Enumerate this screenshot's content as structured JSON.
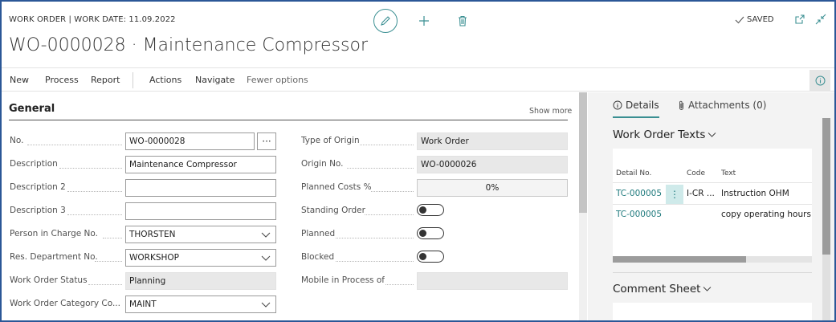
{
  "header": {
    "context": "WORK ORDER | WORK DATE: 11.09.2022",
    "title": "WO-0000028 · Maintenance Compressor",
    "saved_label": "SAVED"
  },
  "toolbar": {
    "edit_icon": "pencil-icon",
    "new_icon": "plus-icon",
    "delete_icon": "trash-icon"
  },
  "actions": {
    "new": "New",
    "process": "Process",
    "report": "Report",
    "actions": "Actions",
    "navigate": "Navigate",
    "fewer": "Fewer options"
  },
  "general": {
    "title": "General",
    "show_more": "Show more",
    "left_fields": [
      {
        "label": "No.",
        "value": "WO-0000028"
      },
      {
        "label": "Description",
        "value": "Maintenance Compressor"
      },
      {
        "label": "Description 2",
        "value": ""
      },
      {
        "label": "Description 3",
        "value": ""
      },
      {
        "label": "Person in Charge No.",
        "value": "THORSTEN"
      },
      {
        "label": "Res. Department No.",
        "value": "WORKSHOP"
      },
      {
        "label": "Work Order Status",
        "value": "Planning"
      },
      {
        "label": "Work Order Category Co...",
        "value": "MAINT"
      }
    ],
    "right_fields": [
      {
        "label": "Type of Origin",
        "value": "Work Order"
      },
      {
        "label": "Origin No.",
        "value": "WO-0000026"
      },
      {
        "label": "Planned Costs %",
        "value": "0%"
      },
      {
        "label": "Standing Order",
        "value": ""
      },
      {
        "label": "Planned",
        "value": ""
      },
      {
        "label": "Blocked",
        "value": ""
      },
      {
        "label": "Mobile in Process of",
        "value": ""
      }
    ],
    "ellipsis": "···"
  },
  "factbox": {
    "tab_details": "Details",
    "tab_attachments": "Attachments (0)",
    "work_order_texts": "Work Order Texts",
    "columns": {
      "detail_no": "Detail No.",
      "code": "Code",
      "text": "Text"
    },
    "rows": [
      {
        "detail_no": "TC-000005",
        "code": "I-CR ...",
        "text": "Instruction OHM"
      },
      {
        "detail_no": "TC-000005",
        "code": "",
        "text": "copy operating hours m"
      }
    ],
    "row_menu": "⋮",
    "comment_sheet": "Comment Sheet"
  },
  "colors": {
    "accent": "#3a8f92",
    "link": "#1f7a7d",
    "frame": "#2b5797"
  }
}
